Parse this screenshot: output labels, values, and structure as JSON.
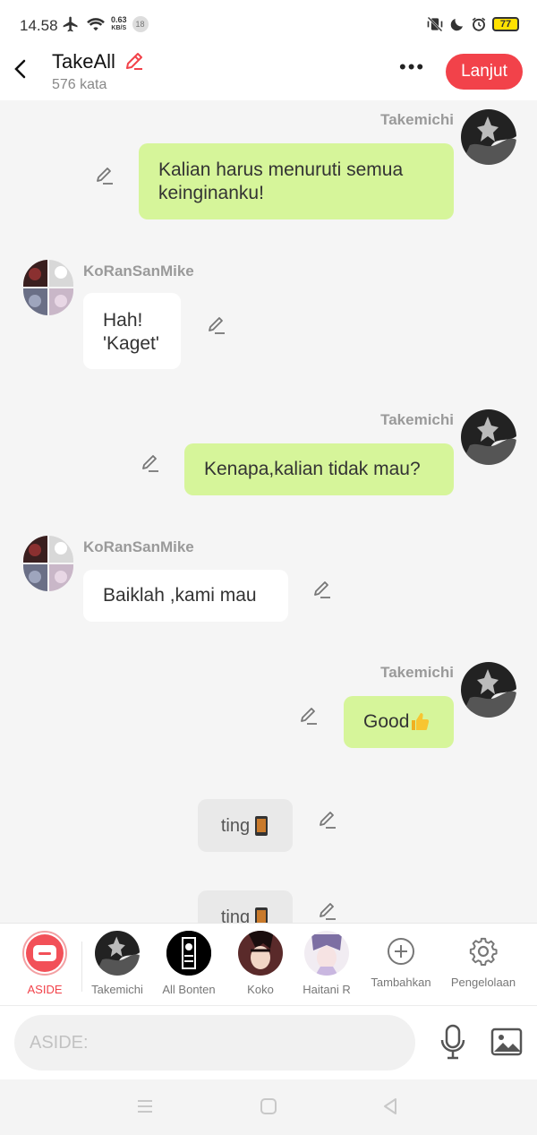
{
  "status_bar": {
    "time": "14.58",
    "speed_value": "0.63",
    "speed_unit": "KB/S",
    "notif_count": "18",
    "battery": "77"
  },
  "header": {
    "title": "TakeAll",
    "word_count": "576 kata",
    "next_label": "Lanjut",
    "more_label": "•••"
  },
  "messages": [
    {
      "sender": "Takemichi",
      "text_lines": [
        "Kalian harus menuruti semua",
        "keinginanku!"
      ]
    },
    {
      "sender": "KoRanSanMike",
      "text_lines": [
        "Hah!",
        "'Kaget'"
      ]
    },
    {
      "sender": "Takemichi",
      "text": "Kenapa,kalian tidak mau?"
    },
    {
      "sender": "KoRanSanMike",
      "text": "Baiklah ,kami mau"
    },
    {
      "sender": "Takemichi",
      "text": "Good",
      "emoji": "thumbs-up"
    },
    {
      "type": "aside",
      "text": "ting",
      "emoji": "phone"
    },
    {
      "type": "aside",
      "text": "ting",
      "emoji": "phone"
    }
  ],
  "characters": [
    {
      "label": "ASIDE",
      "accent": "#f2424a"
    },
    {
      "label": "Takemichi"
    },
    {
      "label": "All Bonten"
    },
    {
      "label": "Koko"
    },
    {
      "label": "Haitani R"
    },
    {
      "label": "Tambahkan",
      "icon": "plus-circle-icon"
    },
    {
      "label": "Pengelolaan",
      "icon": "gear-icon"
    }
  ],
  "input": {
    "placeholder": "ASIDE:"
  },
  "colors": {
    "accent": "#f2424a",
    "right_bubble": "#d6f59a",
    "left_bubble": "#ffffff",
    "aside_bubble": "#e9e9e9"
  }
}
